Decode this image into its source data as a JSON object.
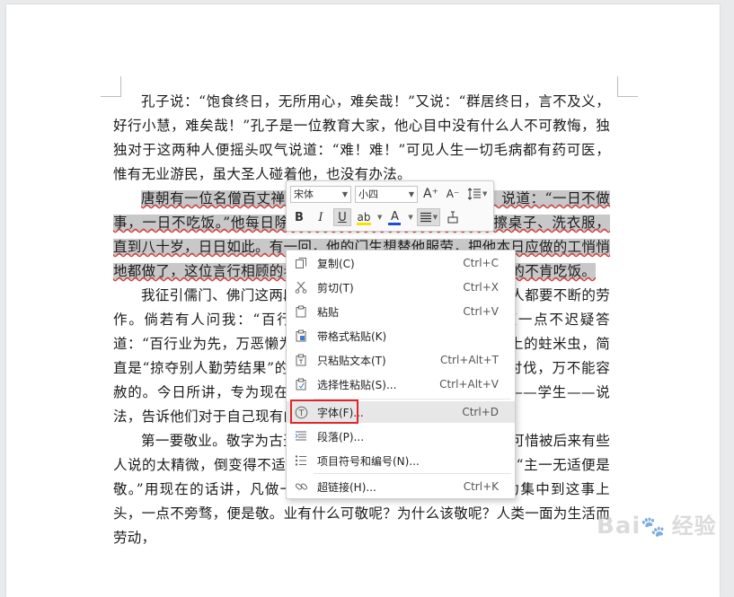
{
  "document": {
    "paragraphs": [
      "孔子说：“饱食终日，无所用心，难矣哉！”又说：“群居终日，言不及义，好行小慧，难矣哉！”孔子是一位教育大家，他心目中没有什么人不可教悔，独独对于这两种人便摇头叹气说道：“难！难！”可见人生一切毛病都有药可医，惟有无业游民，虽大圣人碰着他，也没有办法。",
      "唐朝有一位名僧百丈禅师，他常常用两句格言教训弟子，说道：“一日不做事，一日不吃饭。”他每日除上堂说法之外，还要自己扫地、擦桌子、洗衣服，直到八十岁，日日如此。有一回，他的门生想替他服劳，把他本日应做的工悄悄地都做了，这位言行相顾的老禅师，老实不客气，那一天便绝对的不肯吃饭。",
      "我征引儒门、佛门这两段话，为的是说明人人都有职业，人人都要不断的劳作。倘若有人问我：“百行什么为先？万恶什么为首？”我便一点不迟疑答道：“百行业为先，万恶懒为首。”没有职业的懒人，简直是社会上的蛀米虫，简直是“掠夺别人勤劳结果”的盗贼。我们对于这种人，是要彻底讨伐，万不能容赦的。今日所讲，专为现在有职业及现在正做职业上预备的人——学生——说法，告诉他们对于自己现有的职业应采何种态度。",
      "第一要敬业。敬字为古圣贤教人做人最简易、直捷的法门，可惜被后来有些人说的太精微，倒变得不适实用了。惟有朱子解的最好，他说：“主一无适便是敬。”用现在的话讲，凡做一件事，便忠于一件事，将全副精力集中到这事上头，一点不旁骛，便是敬。业有什么可敬呢？为什么该敬呢？人类一面为生活而劳动，"
    ],
    "selected_text": "唐朝有一位名僧百丈禅师，他常常用两句格言教训弟子，说道：“一日不做事，一日不吃饭。”他每日除上堂说法之外，还要自己扫地、擦桌子、洗衣服，直到八十岁，日日如此。有一回，他的门生想替他服劳，把他本日应做的工悄悄地都做了，这位言行相顾的老禅师，老实不客气，那一天便绝对的不肯吃饭。"
  },
  "mini_toolbar": {
    "font_name": "宋体",
    "font_size": "小四",
    "grow_font": "A⁺",
    "shrink_font": "A⁻",
    "bold": "B",
    "italic": "I",
    "underline": "U",
    "highlight": "ab",
    "font_color": "A",
    "highlight_color": "#f5e400",
    "font_color_value": "#1f4fd1"
  },
  "context_menu": {
    "items": [
      {
        "label": "复制(C)",
        "shortcut": "Ctrl+C",
        "icon": "copy-icon"
      },
      {
        "label": "剪切(T)",
        "shortcut": "Ctrl+X",
        "icon": "cut-icon"
      },
      {
        "label": "粘贴",
        "shortcut": "Ctrl+V",
        "icon": "paste-icon"
      },
      {
        "label": "带格式粘贴(K)",
        "shortcut": "",
        "icon": "paste-format-icon"
      },
      {
        "label": "只粘贴文本(T)",
        "shortcut": "Ctrl+Alt+T",
        "icon": "paste-text-icon"
      },
      {
        "label": "选择性粘贴(S)...",
        "shortcut": "Ctrl+Alt+V",
        "icon": "paste-special-icon"
      },
      {
        "label": "字体(F)...",
        "shortcut": "Ctrl+D",
        "icon": "font-icon"
      },
      {
        "label": "段落(P)...",
        "shortcut": "",
        "icon": "paragraph-icon"
      },
      {
        "label": "项目符号和编号(N)...",
        "shortcut": "",
        "icon": "bullets-icon"
      },
      {
        "label": "超链接(H)...",
        "shortcut": "Ctrl+K",
        "icon": "link-icon"
      }
    ]
  },
  "watermark": {
    "text": "Bai",
    "suffix": "经验"
  }
}
